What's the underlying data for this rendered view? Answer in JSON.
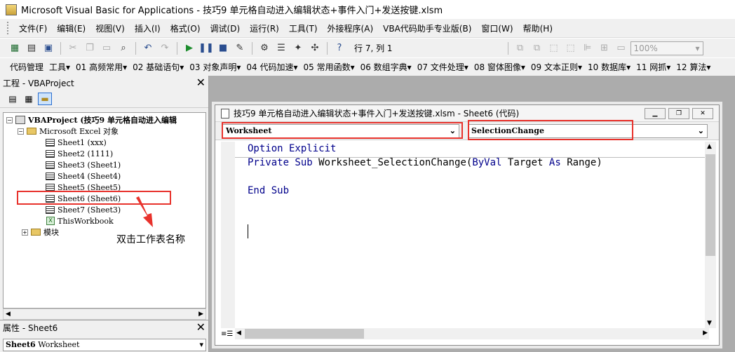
{
  "window": {
    "title": "Microsoft Visual Basic for Applications - 技巧9 单元格自动进入编辑状态+事件入门+发送按键.xlsm"
  },
  "menubar": {
    "items": [
      "文件(F)",
      "编辑(E)",
      "视图(V)",
      "插入(I)",
      "格式(O)",
      "调试(D)",
      "运行(R)",
      "工具(T)",
      "外接程序(A)",
      "VBA代码助手专业版(B)",
      "窗口(W)",
      "帮助(H)"
    ]
  },
  "toolbar": {
    "position": "行 7, 列 1",
    "zoom": "100%"
  },
  "addin_bar": {
    "items": [
      "代码管理",
      "工具▾",
      "01 高频常用▾",
      "02 基础语句▾",
      "03 对象声明▾",
      "04 代码加速▾",
      "05 常用函数▾",
      "06 数组字典▾",
      "07 文件处理▾",
      "08 窗体图像▾",
      "09 文本正则▾",
      "10 数据库▾",
      "11 网抓▾",
      "12 算法▾"
    ]
  },
  "project_panel": {
    "title": "工程 - VBAProject",
    "tree": [
      {
        "label": "VBAProject (技巧9  单元格自动进入编辑",
        "level": 0,
        "icon": "vba-project-icon"
      },
      {
        "label": "Microsoft Excel 对象",
        "level": 1,
        "icon": "folder-icon"
      },
      {
        "label": "Sheet1 (xxx)",
        "level": 2,
        "icon": "sheet-icon"
      },
      {
        "label": "Sheet2 (1111)",
        "level": 2,
        "icon": "sheet-icon"
      },
      {
        "label": "Sheet3 (Sheet1)",
        "level": 2,
        "icon": "sheet-icon"
      },
      {
        "label": "Sheet4 (Sheet4)",
        "level": 2,
        "icon": "sheet-icon"
      },
      {
        "label": "Sheet5 (Sheet5)",
        "level": 2,
        "icon": "sheet-icon"
      },
      {
        "label": "Sheet6 (Sheet6)",
        "level": 2,
        "icon": "sheet-icon"
      },
      {
        "label": "Sheet7 (Sheet3)",
        "level": 2,
        "icon": "sheet-icon"
      },
      {
        "label": "ThisWorkbook",
        "level": 2,
        "icon": "workbook-icon"
      },
      {
        "label": "模块",
        "level": 1,
        "icon": "folder-icon"
      }
    ]
  },
  "properties_panel": {
    "title": "属性 - Sheet6",
    "object_name": "Sheet6",
    "object_type": "Worksheet"
  },
  "code_window": {
    "title": "技巧9 单元格自动进入编辑状态+事件入门+发送按键.xlsm - Sheet6 (代码)",
    "object_combo": "Worksheet",
    "procedure_combo": "SelectionChange",
    "line1_kw": "Option Explicit",
    "line2_kw1": "Private Sub ",
    "line2_name": "Worksheet_SelectionChange(",
    "line2_kw2": "ByVal",
    "line2_mid": " Target ",
    "line2_kw3": "As",
    "line2_end": " Range)",
    "line3_kw": "End Sub"
  },
  "annotation": {
    "text": "双击工作表名称",
    "color": "#e8322c"
  }
}
